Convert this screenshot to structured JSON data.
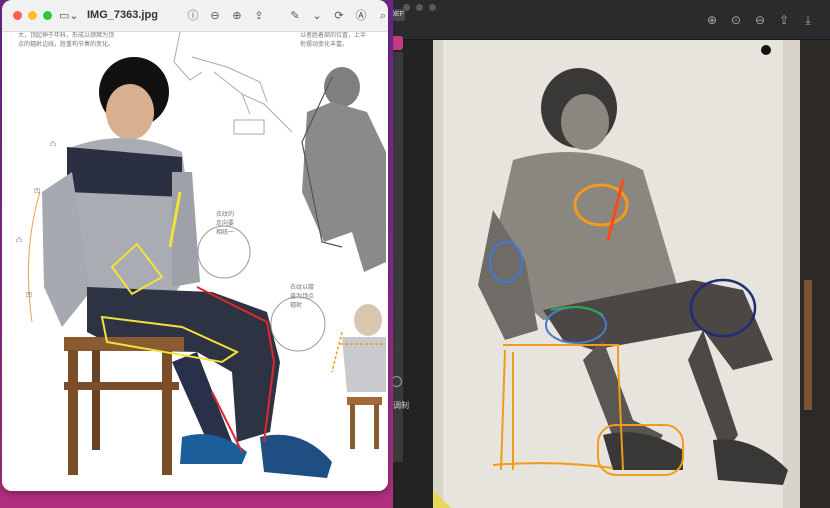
{
  "left_window": {
    "title": "IMG_7363.jpg",
    "toolbar": [
      {
        "icon": "info-icon",
        "glyph": "ⓘ"
      },
      {
        "icon": "zoom-out-icon",
        "glyph": "⊖"
      },
      {
        "icon": "zoom-in-icon",
        "glyph": "⊕"
      },
      {
        "icon": "share-icon",
        "glyph": "⇪"
      },
      {
        "icon": "markup-pen-icon",
        "glyph": "✎"
      },
      {
        "icon": "chevron-down-icon",
        "glyph": "⌄"
      },
      {
        "icon": "rotate-icon",
        "glyph": "⟳"
      },
      {
        "icon": "annotate-icon",
        "glyph": "Ⓐ"
      },
      {
        "icon": "search-icon",
        "glyph": "⌕"
      }
    ],
    "page_text_top_left": [
      "大，顶起伸于年科，形成以颈窝为顶",
      "点的辐射边线，胜重构节奏的变化。"
    ],
    "page_text_top_right": [
      "以者胜着部的位置，上半",
      "衔摆动变化丰富。"
    ],
    "callout_1": [
      "衣纹的",
      "走向要",
      "相统一"
    ],
    "callout_2": [
      "衣纹以膝",
      "盖为顶点",
      "辐射"
    ],
    "side_label_1": "凸",
    "side_label_2": "凹",
    "side_label_3": "凸",
    "side_label_4": "凹"
  },
  "right_window": {
    "toolbar": [
      {
        "icon": "zoom-in-icon",
        "glyph": "⊕"
      },
      {
        "icon": "actual-size-icon",
        "glyph": "⊙"
      },
      {
        "icon": "zoom-out-icon",
        "glyph": "⊖"
      },
      {
        "icon": "share-icon",
        "glyph": "⇪"
      },
      {
        "icon": "download-icon",
        "glyph": "⤓"
      }
    ],
    "badge": "DEF",
    "side_text": "调制"
  }
}
